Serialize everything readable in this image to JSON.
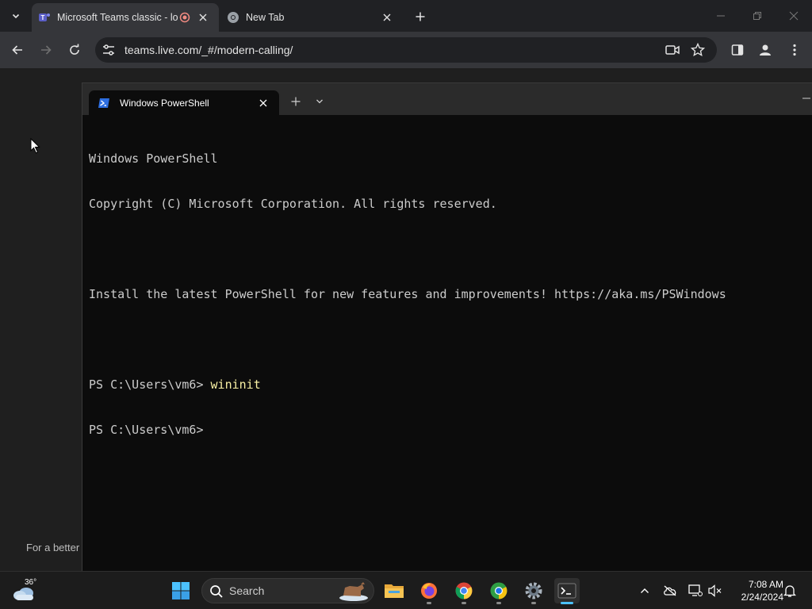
{
  "browser": {
    "tabs": [
      {
        "title": "Microsoft Teams classic - lo",
        "active": true
      },
      {
        "title": "New Tab",
        "active": false
      }
    ],
    "address": "teams.live.com/_#/modern-calling/"
  },
  "page": {
    "hint_text": "For a better"
  },
  "terminal": {
    "tab_title": "Windows PowerShell",
    "lines": [
      "Windows PowerShell",
      "Copyright (C) Microsoft Corporation. All rights reserved.",
      "",
      "Install the latest PowerShell for new features and improvements! https://aka.ms/PSWindows",
      ""
    ],
    "prompt": "PS C:\\Users\\vm6> ",
    "command": "wininit",
    "prompt2": "PS C:\\Users\\vm6>"
  },
  "taskbar": {
    "weather_temp": "36°",
    "search_label": "Search",
    "time": "7:08 AM",
    "date": "2/24/2024"
  },
  "colors": {
    "terminal_bg": "#0c0c0c",
    "command_yellow": "#f9f1a5",
    "taskbar_accent": "#4cc2ff"
  }
}
